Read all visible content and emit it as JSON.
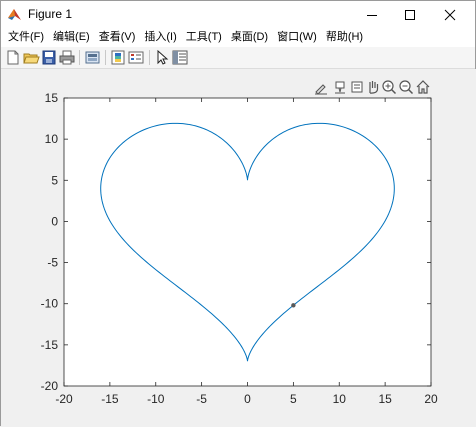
{
  "window": {
    "title": "Figure 1",
    "minimize_icon": "minimize-icon",
    "maximize_icon": "maximize-icon",
    "close_icon": "close-icon"
  },
  "menubar": {
    "items": [
      "文件(F)",
      "编辑(E)",
      "查看(V)",
      "插入(I)",
      "工具(T)",
      "桌面(D)",
      "窗口(W)",
      "帮助(H)"
    ]
  },
  "toolbar": {
    "buttons": [
      "new-figure-icon",
      "open-file-icon",
      "save-icon",
      "print-icon",
      "link-plot-icon",
      "colorbar-icon",
      "legend-icon",
      "edit-plot-icon",
      "property-inspector-icon"
    ]
  },
  "axes_toolbar": {
    "buttons": [
      "brush-icon",
      "data-tips-icon",
      "rotate-icon",
      "pan-icon",
      "zoom-in-icon",
      "zoom-out-icon",
      "home-icon"
    ]
  },
  "colors": {
    "line": "#0072BD",
    "axes_bg": "#ffffff",
    "figure_bg": "#f0f0f0",
    "axis": "#262626",
    "marker": "#595959"
  },
  "chart_data": {
    "type": "line",
    "title": "",
    "xlabel": "",
    "ylabel": "",
    "xlim": [
      -20,
      20
    ],
    "ylim": [
      -20,
      15
    ],
    "xticks": [
      -20,
      -15,
      -10,
      -5,
      0,
      5,
      10,
      15,
      20
    ],
    "yticks": [
      -20,
      -15,
      -10,
      -5,
      0,
      5,
      10,
      15
    ],
    "xtick_labels": [
      "-20",
      "-15",
      "-10",
      "-5",
      "0",
      "5",
      "10",
      "15",
      "20"
    ],
    "ytick_labels": [
      "-20",
      "-15",
      "-10",
      "-5",
      "0",
      "5",
      "10",
      "15"
    ],
    "grid": false,
    "curve": "heart",
    "series": [
      {
        "x": [
          0,
          0.6,
          2.3,
          4.9,
          7.8,
          10.6,
          13.0,
          14.7,
          15.8,
          16.0,
          15.5,
          14.3,
          12.6,
          10.5,
          8.2,
          5.7,
          3.0,
          1.0,
          0,
          -1.0,
          -3.0,
          -5.7,
          -8.2,
          -10.5,
          -12.6,
          -14.3,
          -15.5,
          -16.0,
          -15.8,
          -14.7,
          -13.0,
          -10.6,
          -7.8,
          -4.9,
          -2.3,
          -0.6,
          0
        ],
        "y": [
          5.0,
          7.7,
          9.9,
          11.4,
          11.9,
          11.4,
          9.9,
          7.7,
          5.2,
          2.5,
          -0.1,
          -2.5,
          -4.4,
          -6.0,
          -7.7,
          -9.5,
          -11.7,
          -14.3,
          -17.0,
          -14.3,
          -11.7,
          -9.5,
          -7.7,
          -6.0,
          -4.4,
          -2.5,
          -0.1,
          2.5,
          5.2,
          7.7,
          9.9,
          11.4,
          11.9,
          11.4,
          9.9,
          7.7,
          5.0
        ]
      }
    ],
    "marker_point": {
      "x": 5.0,
      "y": -10.2
    }
  }
}
